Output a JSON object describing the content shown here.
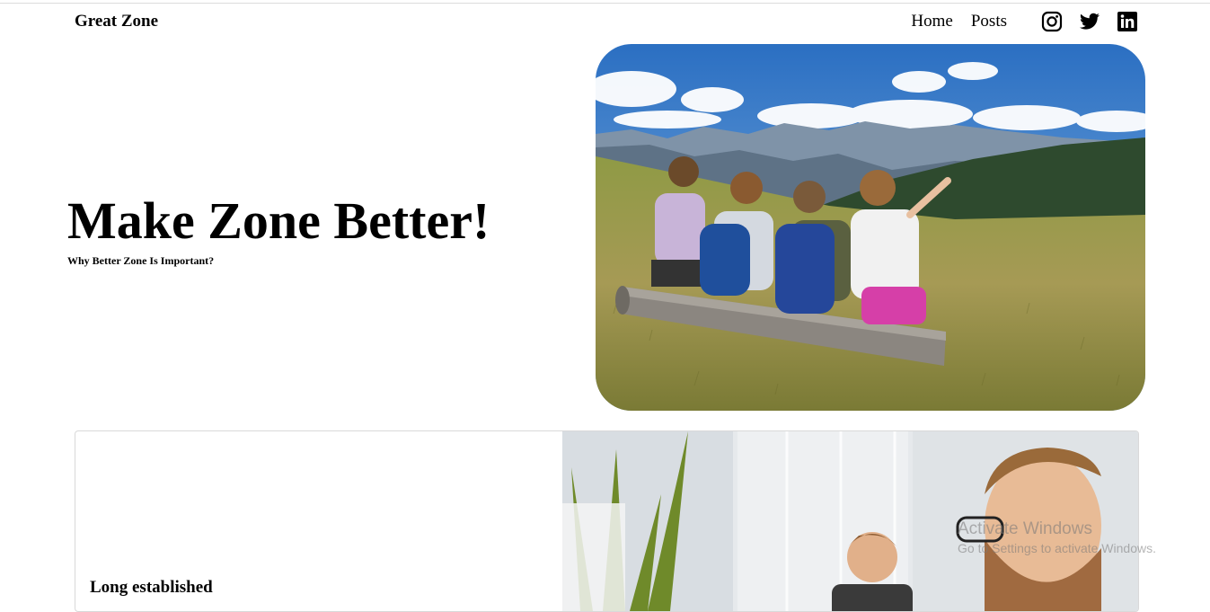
{
  "nav": {
    "brand": "Great Zone",
    "links": [
      "Home",
      "Posts"
    ],
    "social_icons": [
      "instagram-icon",
      "twitter-icon",
      "linkedin-icon"
    ]
  },
  "hero": {
    "title": "Make Zone Better!",
    "subtitle": "Why Better Zone Is Important?",
    "image": "hikers-on-mountain-meadow"
  },
  "card": {
    "title": "Long established",
    "image": "office-workers-with-plant"
  },
  "watermark": {
    "title": "Activate Windows",
    "subtitle": "Go to Settings to activate Windows."
  }
}
